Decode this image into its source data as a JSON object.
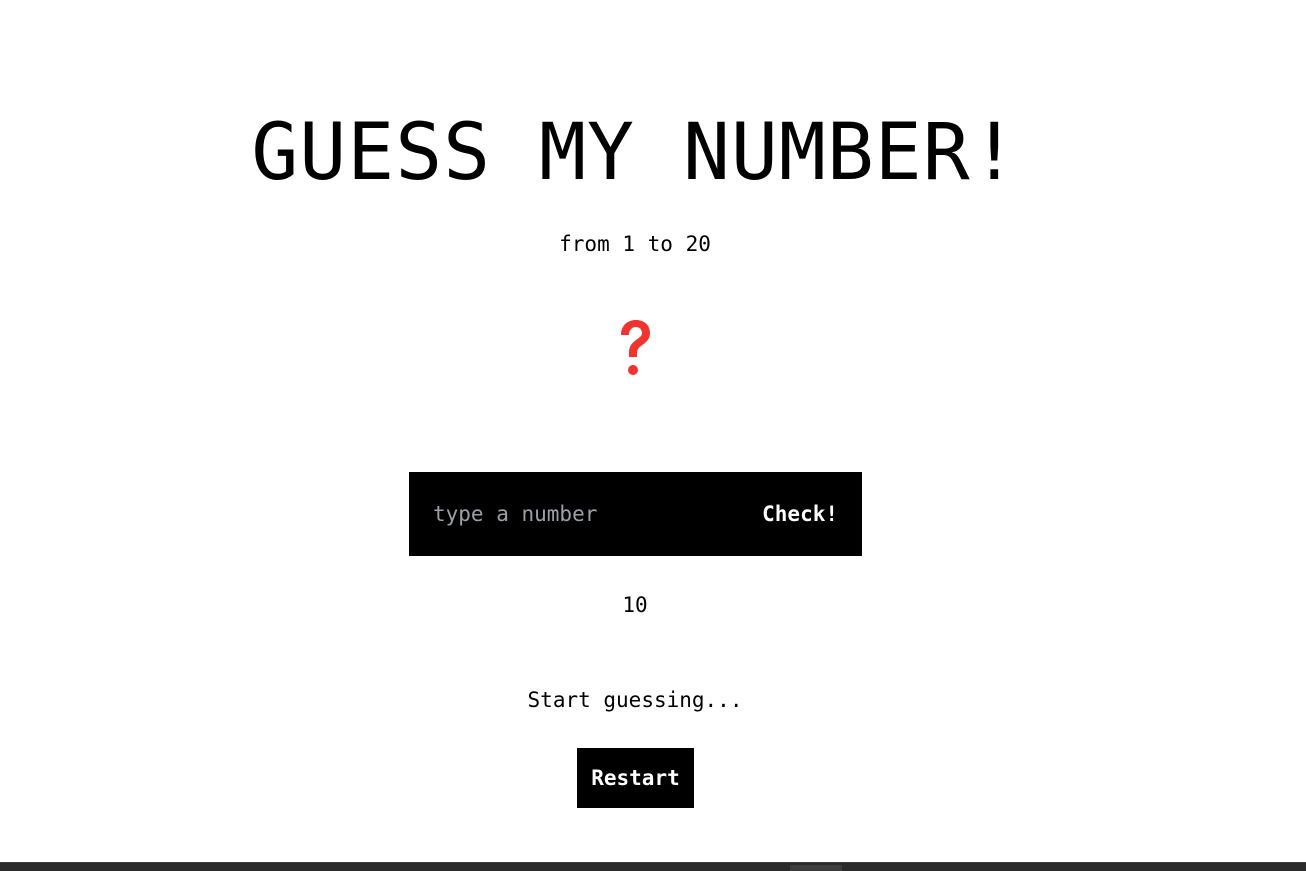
{
  "game": {
    "title": "GUESS MY NUMBER!",
    "range_text": "from 1 to 20",
    "secret_display_icon": "question-mark-icon",
    "input_placeholder": "type a number",
    "check_label": "Check!",
    "score": "10",
    "message": "Start guessing...",
    "restart_label": "Restart"
  },
  "colors": {
    "accent": "#f0342f",
    "bar_background": "#000000",
    "page_background": "#ffffff"
  }
}
